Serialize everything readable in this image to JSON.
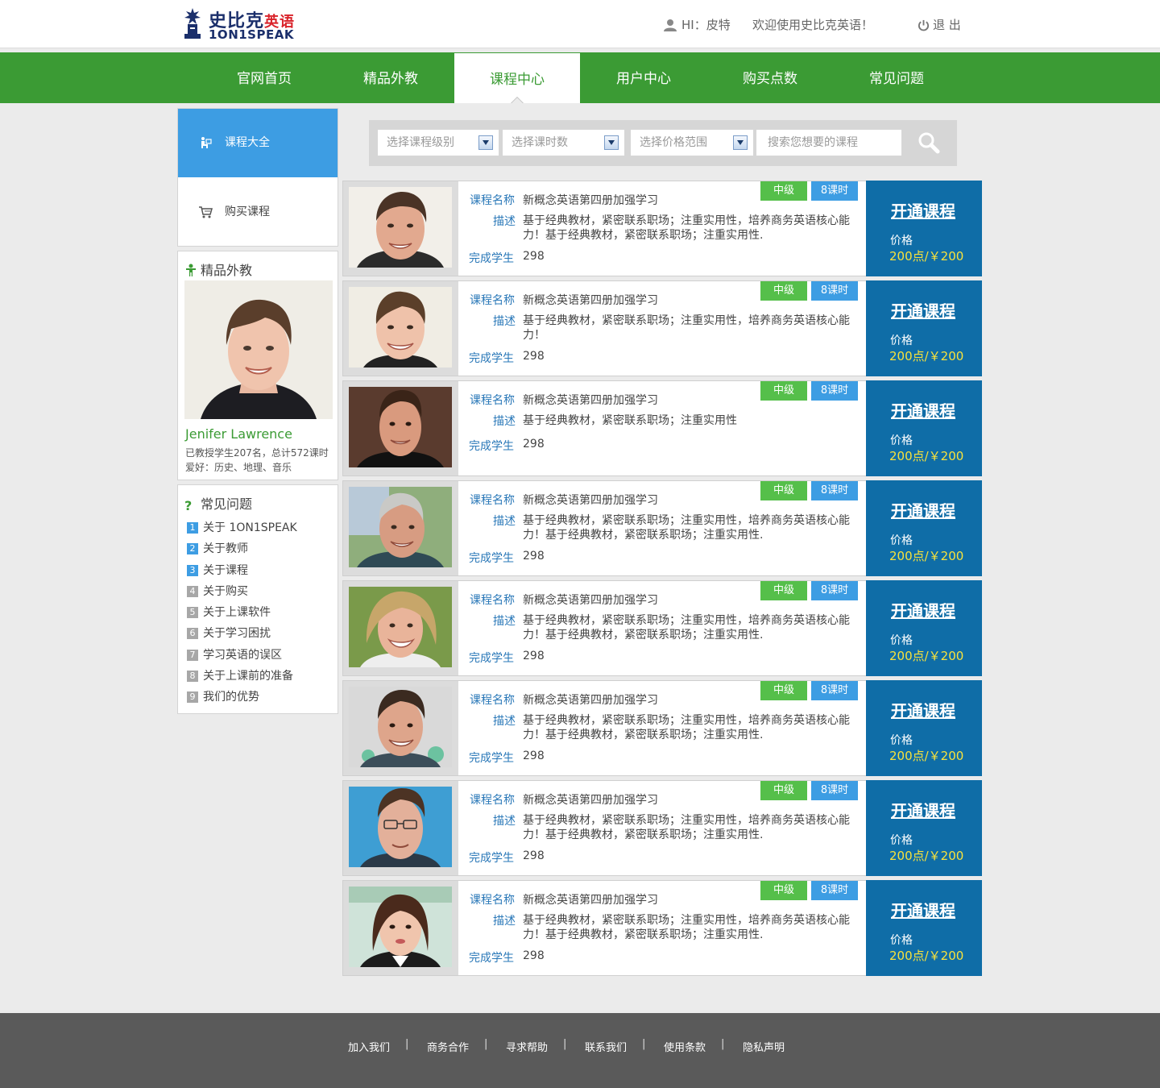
{
  "header": {
    "logo_cn_main": "史比克",
    "logo_cn_red": "英语",
    "logo_en": "1ON1SPEAK",
    "greeting": "HI：皮特",
    "welcome": "欢迎使用史比克英语！",
    "logout": "退 出"
  },
  "nav": [
    {
      "label": "官网首页"
    },
    {
      "label": "精品外教"
    },
    {
      "label": "课程中心",
      "active": true
    },
    {
      "label": "用户中心"
    },
    {
      "label": "购买点数"
    },
    {
      "label": "常见问题"
    }
  ],
  "sidebar": {
    "menu": [
      {
        "label": "课程大全",
        "icon": "course-list-icon",
        "active": true
      },
      {
        "label": "购买课程",
        "icon": "cart-icon"
      }
    ],
    "teacher_box": {
      "title": "精品外教",
      "name": "Jenifer Lawrence",
      "stats": "已教授学生207名，总计572课时",
      "hobbies": "爱好：历史、地理、音乐"
    },
    "faq": {
      "title": "常见问题",
      "items": [
        {
          "num": "1",
          "label": "关于 1ON1SPEAK"
        },
        {
          "num": "2",
          "label": "关于教师"
        },
        {
          "num": "3",
          "label": "关于课程"
        },
        {
          "num": "4",
          "label": "关于购买"
        },
        {
          "num": "5",
          "label": "关于上课软件"
        },
        {
          "num": "6",
          "label": "关于学习困扰"
        },
        {
          "num": "7",
          "label": "学习英语的误区"
        },
        {
          "num": "8",
          "label": "关于上课前的准备"
        },
        {
          "num": "9",
          "label": "我们的优势"
        }
      ]
    }
  },
  "search": {
    "level_select": "选择课程级别",
    "hours_select": "选择课时数",
    "price_select": "选择价格范围",
    "placeholder": "搜索您想要的课程"
  },
  "course_labels": {
    "name": "课程名称",
    "desc": "描述",
    "students": "完成学生",
    "open": "开通课程",
    "price": "价格"
  },
  "courses": [
    {
      "name": "新概念英语第四册加强学习",
      "desc": "基于经典教材，紧密联系职场；注重实用性，培养商务英语核心能力！基于经典教材，紧密联系职场；注重实用性.",
      "students": "298",
      "level": "中级",
      "hours": "8课时",
      "price": "200点/￥200"
    },
    {
      "name": "新概念英语第四册加强学习",
      "desc": "基于经典教材，紧密联系职场；注重实用性，培养商务英语核心能力！",
      "students": "298",
      "level": "中级",
      "hours": "8课时",
      "price": "200点/￥200"
    },
    {
      "name": "新概念英语第四册加强学习",
      "desc": "基于经典教材，紧密联系职场；注重实用性",
      "students": "298",
      "level": "中级",
      "hours": "8课时",
      "price": "200点/￥200"
    },
    {
      "name": "新概念英语第四册加强学习",
      "desc": "基于经典教材，紧密联系职场；注重实用性，培养商务英语核心能力！基于经典教材，紧密联系职场；注重实用性.",
      "students": "298",
      "level": "中级",
      "hours": "8课时",
      "price": "200点/￥200"
    },
    {
      "name": "新概念英语第四册加强学习",
      "desc": "基于经典教材，紧密联系职场；注重实用性，培养商务英语核心能力！基于经典教材，紧密联系职场；注重实用性.",
      "students": "298",
      "level": "中级",
      "hours": "8课时",
      "price": "200点/￥200"
    },
    {
      "name": "新概念英语第四册加强学习",
      "desc": "基于经典教材，紧密联系职场；注重实用性，培养商务英语核心能力！基于经典教材，紧密联系职场；注重实用性.",
      "students": "298",
      "level": "中级",
      "hours": "8课时",
      "price": "200点/￥200"
    },
    {
      "name": "新概念英语第四册加强学习",
      "desc": "基于经典教材，紧密联系职场；注重实用性，培养商务英语核心能力！基于经典教材，紧密联系职场；注重实用性.",
      "students": "298",
      "level": "中级",
      "hours": "8课时",
      "price": "200点/￥200"
    },
    {
      "name": "新概念英语第四册加强学习",
      "desc": "基于经典教材，紧密联系职场；注重实用性，培养商务英语核心能力！基于经典教材，紧密联系职场；注重实用性.",
      "students": "298",
      "level": "中级",
      "hours": "8课时",
      "price": "200点/￥200"
    }
  ],
  "footer": {
    "links": [
      {
        "label": "加入我们"
      },
      {
        "label": "商务合作"
      },
      {
        "label": "寻求帮助"
      },
      {
        "label": "联系我们"
      },
      {
        "label": "使用条款"
      },
      {
        "label": "隐私声明"
      }
    ]
  },
  "colors": {
    "nav_green": "#3b9b34",
    "accent_blue": "#3d9de3",
    "action_blue": "#0f6da7",
    "price_yellow": "#f7e13c",
    "footer_gray": "#5a5a5a"
  }
}
